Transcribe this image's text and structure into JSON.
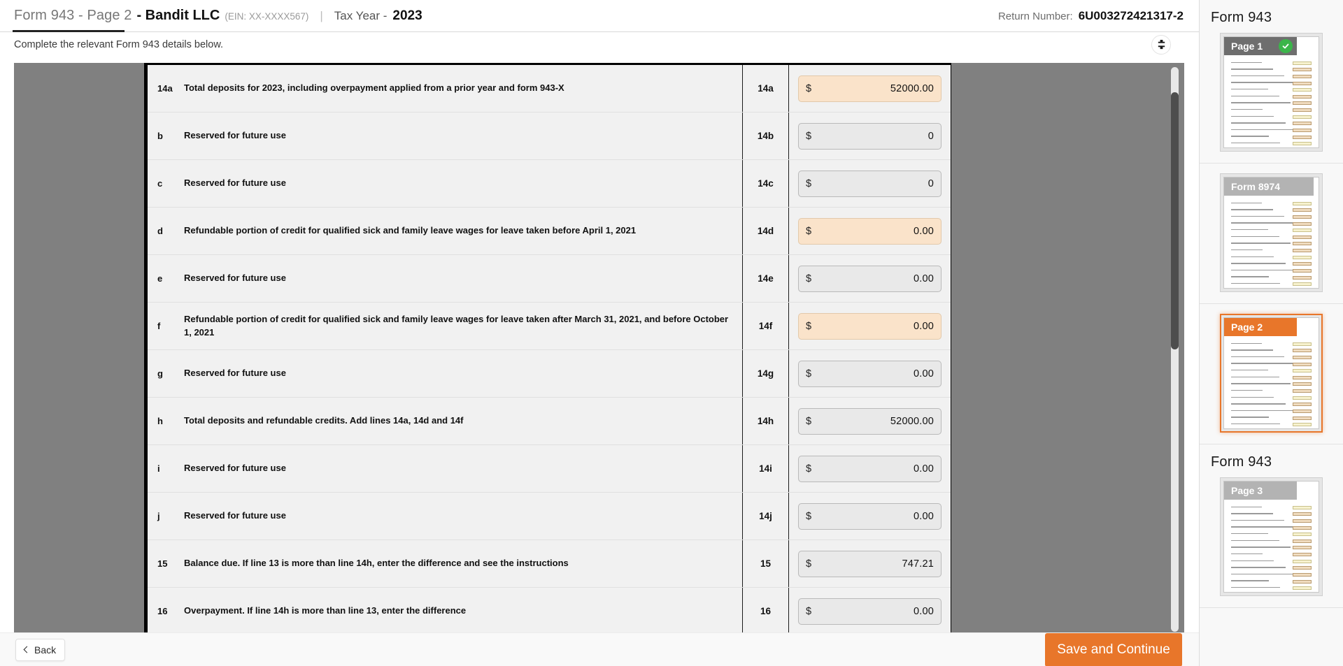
{
  "header": {
    "form_page": "Form 943 - Page 2",
    "company": "- Bandit LLC",
    "ein": "(EIN: XX-XXXX567)",
    "pipe": "|",
    "tax_year_label": "Tax Year -",
    "tax_year_value": "2023",
    "return_number_label": "Return Number:",
    "return_number_value": "6U003272421317-2",
    "collapse_icon": "collapse-icon"
  },
  "subheader": {
    "instruction": "Complete the relevant Form 943 details below."
  },
  "form": {
    "rows": [
      {
        "key": "14a",
        "text": "Total deposits for 2023, including overpayment applied from a prior year and form 943-X",
        "line": "14a",
        "currency": "$",
        "value": "52000.00",
        "highlight": true
      },
      {
        "key": "b",
        "text": "Reserved for future use",
        "line": "14b",
        "currency": "$",
        "value": "0",
        "highlight": false
      },
      {
        "key": "c",
        "text": "Reserved for future use",
        "line": "14c",
        "currency": "$",
        "value": "0",
        "highlight": false
      },
      {
        "key": "d",
        "text": "Refundable portion of credit for qualified sick and family leave wages for leave taken before April 1, 2021",
        "line": "14d",
        "currency": "$",
        "value": "0.00",
        "highlight": true
      },
      {
        "key": "e",
        "text": "Reserved for future use",
        "line": "14e",
        "currency": "$",
        "value": "0.00",
        "highlight": false
      },
      {
        "key": "f",
        "text": "Refundable portion of credit for qualified sick and family leave wages for leave taken after March 31, 2021, and before October 1, 2021",
        "line": "14f",
        "currency": "$",
        "value": "0.00",
        "highlight": true
      },
      {
        "key": "g",
        "text": "Reserved for future use",
        "line": "14g",
        "currency": "$",
        "value": "0.00",
        "highlight": false
      },
      {
        "key": "h",
        "text": "Total deposits and refundable credits. Add lines 14a, 14d and 14f",
        "line": "14h",
        "currency": "$",
        "value": "52000.00",
        "highlight": false
      },
      {
        "key": "i",
        "text": "Reserved for future use",
        "line": "14i",
        "currency": "$",
        "value": "0.00",
        "highlight": false
      },
      {
        "key": "j",
        "text": "Reserved for future use",
        "line": "14j",
        "currency": "$",
        "value": "0.00",
        "highlight": false
      },
      {
        "key": "15",
        "text": "Balance due. If line 13 is more than line 14h, enter the difference and see the instructions",
        "line": "15",
        "currency": "$",
        "value": "747.21",
        "highlight": false
      },
      {
        "key": "16",
        "text": "Overpayment. If line 14h is more than line 13, enter the difference",
        "line": "16",
        "currency": "$",
        "value": "0.00",
        "highlight": false
      }
    ]
  },
  "footer": {
    "back_label": "Back",
    "save_label": "Save and Continue"
  },
  "sidebar": {
    "groups": [
      {
        "title": "Form 943",
        "thumb_label": "Page 1",
        "badge_style": "gray",
        "checked": true,
        "selected": false
      },
      {
        "title": "",
        "thumb_label": "Form 8974",
        "badge_style": "grayish",
        "checked": false,
        "selected": false
      },
      {
        "title": "",
        "thumb_label": "Page 2",
        "badge_style": "orange",
        "checked": false,
        "selected": true
      },
      {
        "title": "Form 943",
        "thumb_label": "Page 3",
        "badge_style": "grayish",
        "checked": false,
        "selected": false
      }
    ]
  },
  "colors": {
    "accent_orange": "#e8762a",
    "highlight_field": "#fae3ca",
    "field_gray": "#e9e9e9",
    "doc_backdrop": "#808080",
    "check_green": "#3bb54a"
  }
}
